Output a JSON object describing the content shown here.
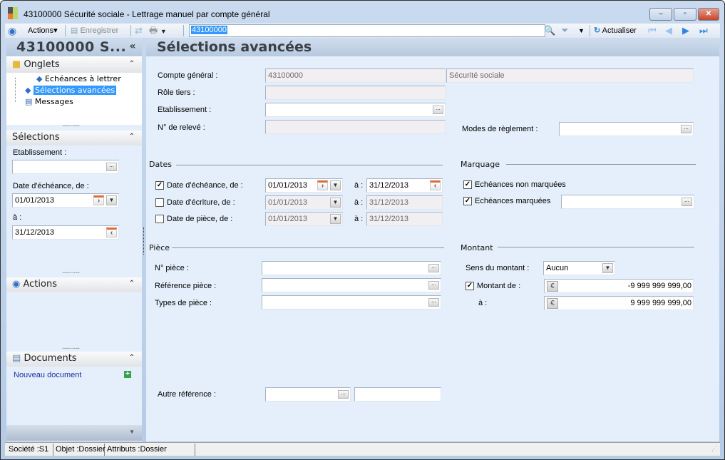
{
  "window": {
    "title": "43100000 Sécurité sociale -  Lettrage manuel par compte général",
    "minimize": "–",
    "maximize": "▫",
    "close": "✕"
  },
  "toolbar": {
    "actions_label": "Actions",
    "save_label": "Enregistrer",
    "search_value": "43100000",
    "refresh_label": "Actualiser"
  },
  "left": {
    "title": "43100000 S...",
    "collapse": "«",
    "onglets": {
      "header": "Onglets",
      "items": [
        "Echéances à lettrer",
        "Sélections avancées",
        "Messages"
      ]
    },
    "selections": {
      "header": "Sélections",
      "etablissement_label": "Etablissement :",
      "etablissement_value": "",
      "date_label": "Date d'échéance, de :",
      "date_from": "01/01/2013",
      "a_label": "à :",
      "date_to": "31/12/2013"
    },
    "actions": {
      "header": "Actions"
    },
    "documents": {
      "header": "Documents",
      "new_document": "Nouveau document"
    },
    "splitter": "........."
  },
  "main": {
    "title": "Sélections avancées",
    "compte_label": "Compte général :",
    "compte_value": "43100000",
    "compte_name": "Sécurité sociale",
    "role_label": "Rôle tiers :",
    "role_value": "",
    "etab_label": "Etablissement :",
    "etab_value": "",
    "releve_label": "N° de relevé :",
    "releve_value": "",
    "modes_label": "Modes de règlement :",
    "modes_value": "",
    "dates": {
      "header": "Dates",
      "a_label": "à :",
      "rows": [
        {
          "label": "Date d'échéance, de :",
          "checked": true,
          "from": "01/01/2013",
          "to": "31/12/2013"
        },
        {
          "label": "Date d'écriture, de :",
          "checked": false,
          "from": "01/01/2013",
          "to": "31/12/2013"
        },
        {
          "label": "Date de pièce, de :",
          "checked": false,
          "from": "01/01/2013",
          "to": "31/12/2013"
        }
      ]
    },
    "marquage": {
      "header": "Marquage",
      "non_marquees": "Echéances non marquées",
      "non_marquees_checked": true,
      "marquees": "Echéances marquées",
      "marquees_checked": true,
      "marquees_value": ""
    },
    "piece": {
      "header": "Pièce",
      "num_label": "N° pièce :",
      "ref_label": "Référence pièce :",
      "types_label": "Types de pièce :"
    },
    "montant": {
      "header": "Montant",
      "sens_label": "Sens du montant :",
      "sens_value": "Aucun",
      "de_label": "Montant de :",
      "de_checked": true,
      "de_value": "-9 999 999 999,00",
      "a_label": "à :",
      "a_value": "9 999 999 999,00",
      "currency": "€"
    },
    "autre_label": "Autre référence :"
  },
  "status": {
    "societe": "Société :S1",
    "objet": "Objet :Dossier",
    "attributs": "Attributs :Dossier"
  },
  "colors": {
    "accent": "#3399ff",
    "panel": "#e4effb"
  }
}
